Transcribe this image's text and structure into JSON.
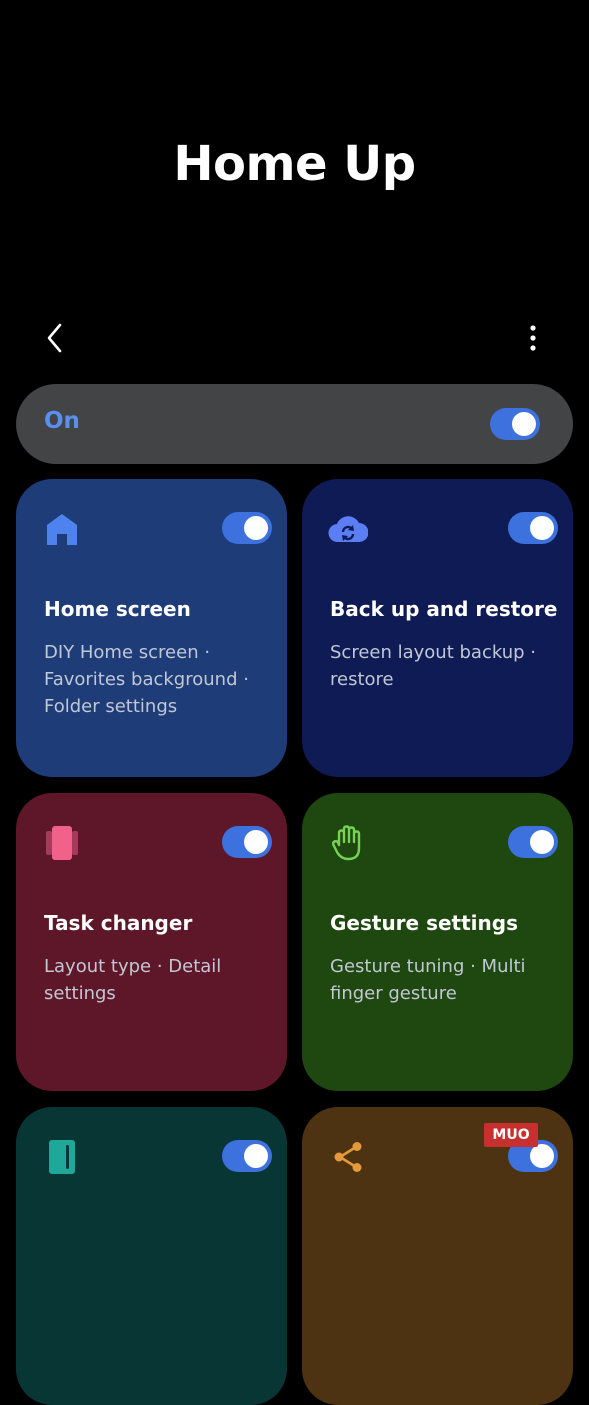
{
  "header": {
    "title": "Home Up"
  },
  "topbar": {
    "back_icon": "chevron-left-icon",
    "more_icon": "more-vertical-icon"
  },
  "master_switch": {
    "label": "On",
    "checked": true
  },
  "cards": [
    {
      "title": "Home screen",
      "description": "DIY Home screen · Favorites background · Folder settings",
      "icon": "home-icon",
      "color": "#1d3c78",
      "icon_color": "#4e83ee",
      "enabled": true
    },
    {
      "title": "Back up and restore",
      "description": "Screen layout backup · restore",
      "icon": "cloud-sync-icon",
      "color": "#0f1b55",
      "icon_color": "#5b7ef5",
      "enabled": true
    },
    {
      "title": "Task changer",
      "description": "Layout type · Detail settings",
      "icon": "task-cards-icon",
      "color": "#5e1729",
      "icon_color": "#f2618a",
      "enabled": true
    },
    {
      "title": "Gesture settings",
      "description": "Gesture tuning · Multi finger gesture",
      "icon": "hand-icon",
      "color": "#1f4710",
      "icon_color": "#76d255",
      "enabled": true
    },
    {
      "title": "",
      "description": "",
      "icon": "panel-icon",
      "color": "#083634",
      "icon_color": "#1fa89a",
      "enabled": true
    },
    {
      "title": "",
      "description": "",
      "icon": "share-icon",
      "color": "#4d3311",
      "icon_color": "#e29a3a",
      "enabled": true
    }
  ],
  "watermark": {
    "text": "MUO"
  },
  "colors": {
    "background": "#000000",
    "accent": "#3d71de",
    "switch_bar": "#434446"
  }
}
